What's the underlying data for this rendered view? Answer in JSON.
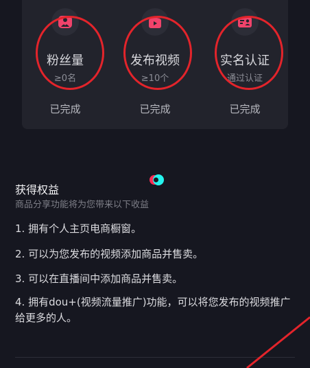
{
  "requirements": [
    {
      "title": "粉丝量",
      "sub": "≥0名",
      "status": "已完成",
      "icon": "heart-person-icon"
    },
    {
      "title": "发布视频",
      "sub": "≥10个",
      "status": "已完成",
      "icon": "video-clapper-icon"
    },
    {
      "title": "实名认证",
      "sub": "通过认证",
      "status": "已完成",
      "icon": "id-card-icon"
    }
  ],
  "benefits_section": {
    "title": "获得权益",
    "subtitle": "商品分享功能将为您带来以下收益",
    "items": [
      "1. 拥有个人主页电商橱窗。",
      "2. 可以为您发布的视频添加商品并售卖。",
      "3. 可以在直播间中添加商品并售卖。",
      "4. 拥有dou+(视频流量推广)功能，可以将您发布的视频推广给更多的人。"
    ]
  },
  "colors": {
    "background": "#161720",
    "card": "#22232c",
    "icon_accent": "#f0436b",
    "annotation_red": "#e3242b"
  }
}
